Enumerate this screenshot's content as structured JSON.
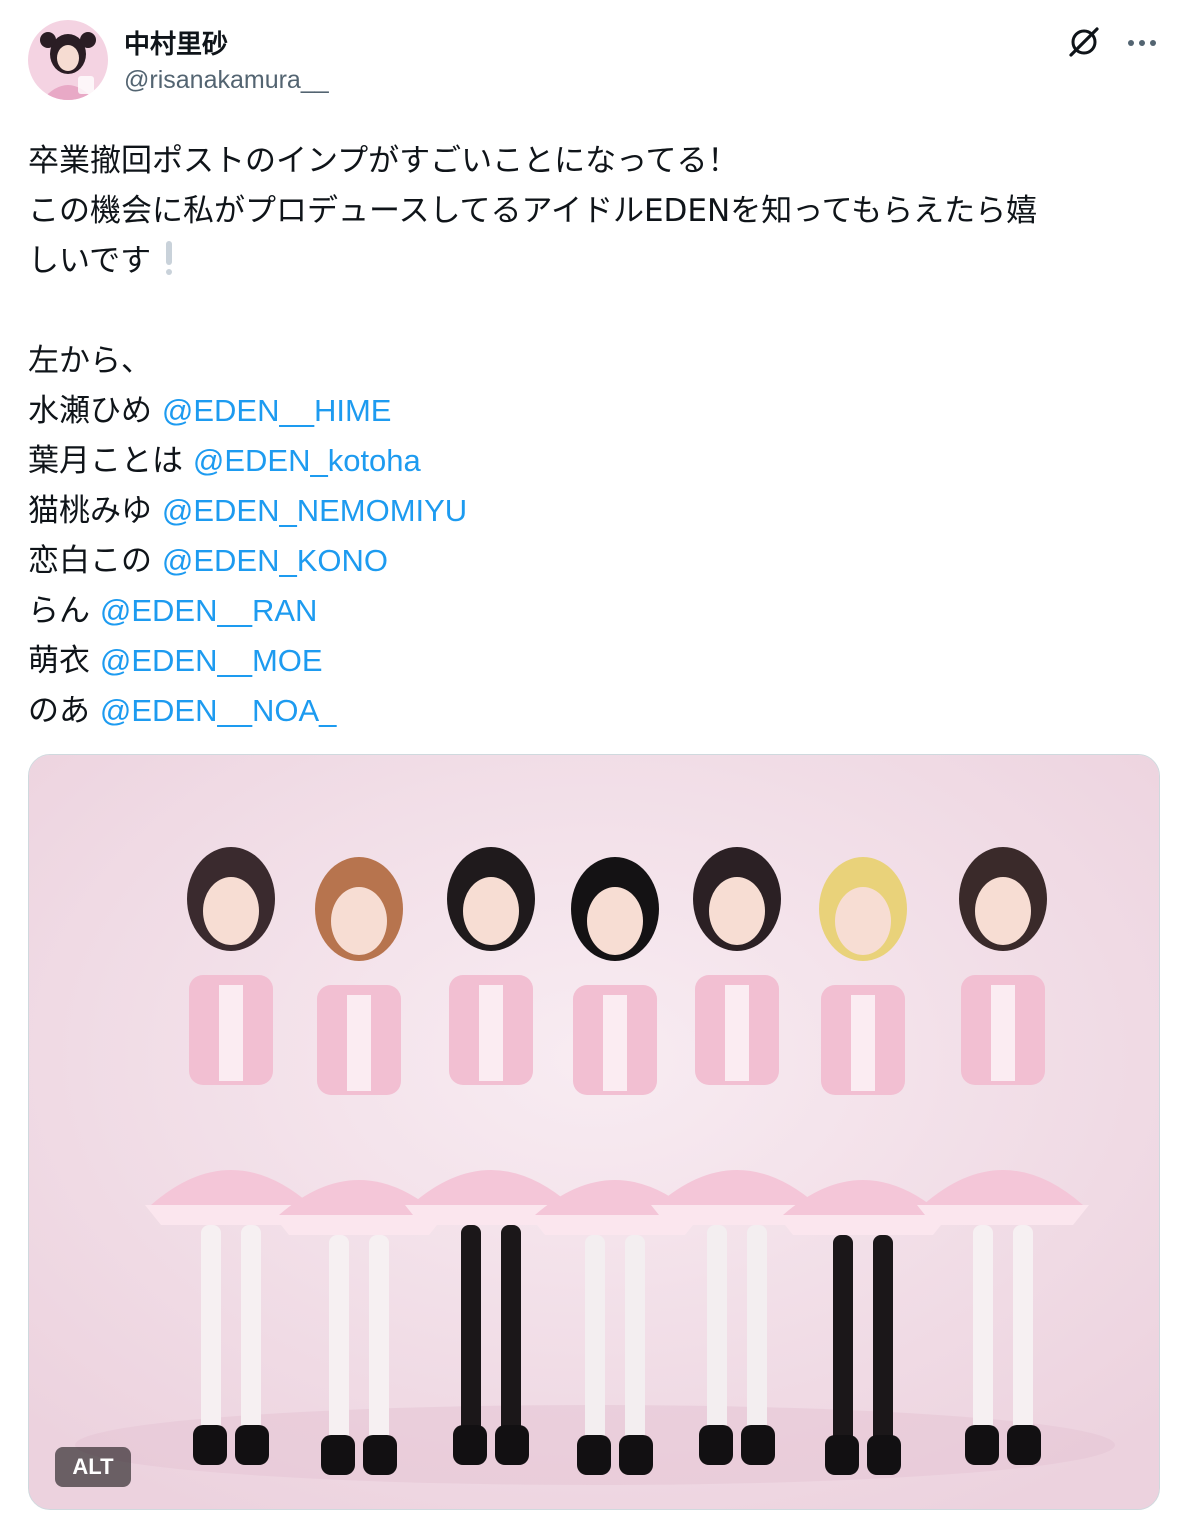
{
  "author": {
    "display_name": "中村里砂",
    "handle": "@risanakamura__"
  },
  "icons": {
    "grok": "grok-icon",
    "more": "more-horizontal-icon",
    "emoji": "white-exclamation-emoji-icon"
  },
  "post": {
    "lines": [
      "卒業撤回ポストのインプがすごいことになってる！",
      "この機会に私がプロデュースしてるアイドルEDENを知ってもらえたら嬉",
      "しいです"
    ],
    "intro": "左から、",
    "members": [
      {
        "name": "水瀬ひめ",
        "mention": "@EDEN__HIME"
      },
      {
        "name": "葉月ことは",
        "mention": "@EDEN_kotoha"
      },
      {
        "name": "猫桃みゆ",
        "mention": "@EDEN_NEMOMIYU"
      },
      {
        "name": "恋白この",
        "mention": "@EDEN_KONO"
      },
      {
        "name": "らん",
        "mention": "@EDEN__RAN"
      },
      {
        "name": "萌衣",
        "mention": "@EDEN__MOE"
      },
      {
        "name": "のあ",
        "mention": "@EDEN__NOA_"
      }
    ]
  },
  "media": {
    "alt_label": "ALT",
    "background_color": "#f1dbe5"
  },
  "colors": {
    "text": "#0f1419",
    "secondary": "#536471",
    "link": "#1d9bf0"
  }
}
